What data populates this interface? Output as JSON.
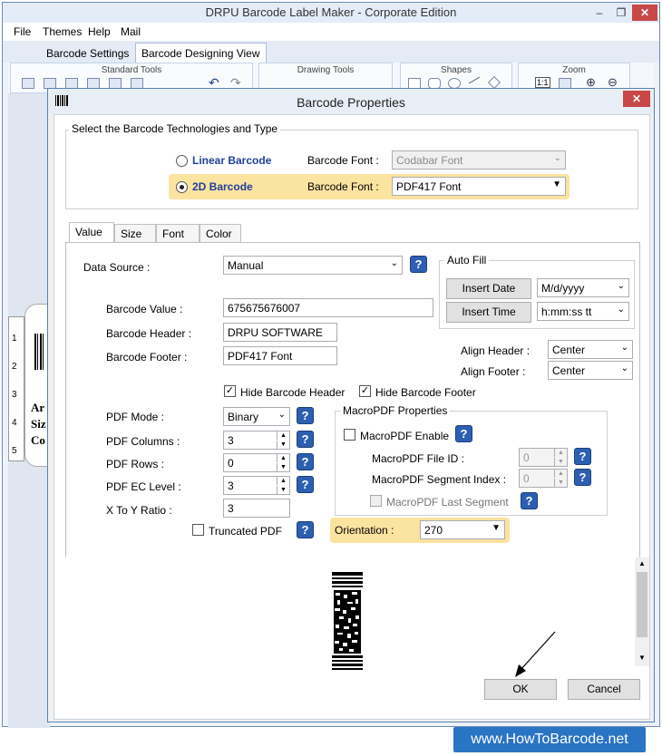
{
  "app": {
    "title": "DRPU Barcode Label Maker - Corporate Edition",
    "menu": [
      "File",
      "Themes",
      "Help",
      "Mail"
    ],
    "tabs": [
      "Barcode Settings",
      "Barcode Designing View"
    ],
    "ribbon_groups": [
      "Standard Tools",
      "Drawing Tools",
      "Shapes",
      "Zoom"
    ],
    "ruler": [
      "1",
      "2",
      "3",
      "4",
      "5"
    ],
    "canvas_text": [
      "Ar",
      "Siz",
      "Co"
    ]
  },
  "dialog": {
    "title": "Barcode Properties",
    "tech_group_title": "Select the Barcode Technologies and Type",
    "linear_label": "Linear Barcode",
    "linear_font_label": "Barcode Font :",
    "linear_font_value": "Codabar Font",
    "twod_label": "2D Barcode",
    "twod_font_label": "Barcode Font :",
    "twod_font_value": "PDF417 Font",
    "tabs": [
      "Value",
      "Size",
      "Font",
      "Color"
    ],
    "data_source_label": "Data Source :",
    "data_source_value": "Manual",
    "barcode_value_label": "Barcode Value :",
    "barcode_value": "675675676007",
    "barcode_header_label": "Barcode Header :",
    "barcode_header": "DRPU SOFTWARE",
    "barcode_footer_label": "Barcode Footer :",
    "barcode_footer": "PDF417 Font",
    "autofill_title": "Auto Fill",
    "insert_date_label": "Insert Date",
    "date_format": "M/d/yyyy",
    "insert_time_label": "Insert Time",
    "time_format": "h:mm:ss tt",
    "align_header_label": "Align Header :",
    "align_header_value": "Center",
    "align_footer_label": "Align Footer :",
    "align_footer_value": "Center",
    "hide_header_label": "Hide Barcode Header",
    "hide_footer_label": "Hide Barcode Footer",
    "pdf_mode_label": "PDF Mode :",
    "pdf_mode_value": "Binary",
    "pdf_columns_label": "PDF Columns :",
    "pdf_columns_value": "3",
    "pdf_rows_label": "PDF Rows :",
    "pdf_rows_value": "0",
    "pdf_ec_label": "PDF EC Level :",
    "pdf_ec_value": "3",
    "xy_ratio_label": "X To Y Ratio :",
    "xy_ratio_value": "3",
    "truncated_label": "Truncated PDF",
    "macro_title": "MacroPDF Properties",
    "macro_enable_label": "MacroPDF Enable",
    "macro_file_id_label": "MacroPDF File ID :",
    "macro_file_id_value": "0",
    "macro_segment_label": "MacroPDF Segment Index :",
    "macro_segment_value": "0",
    "macro_last_label": "MacroPDF Last Segment",
    "orientation_label": "Orientation :",
    "orientation_value": "270",
    "ok_label": "OK",
    "cancel_label": "Cancel"
  },
  "watermark": "www.HowToBarcode.net",
  "colors": {
    "highlight": "#fbe3a0",
    "help": "#2c5fb2",
    "close": "#c74846",
    "link_blue": "#1f3f99"
  }
}
